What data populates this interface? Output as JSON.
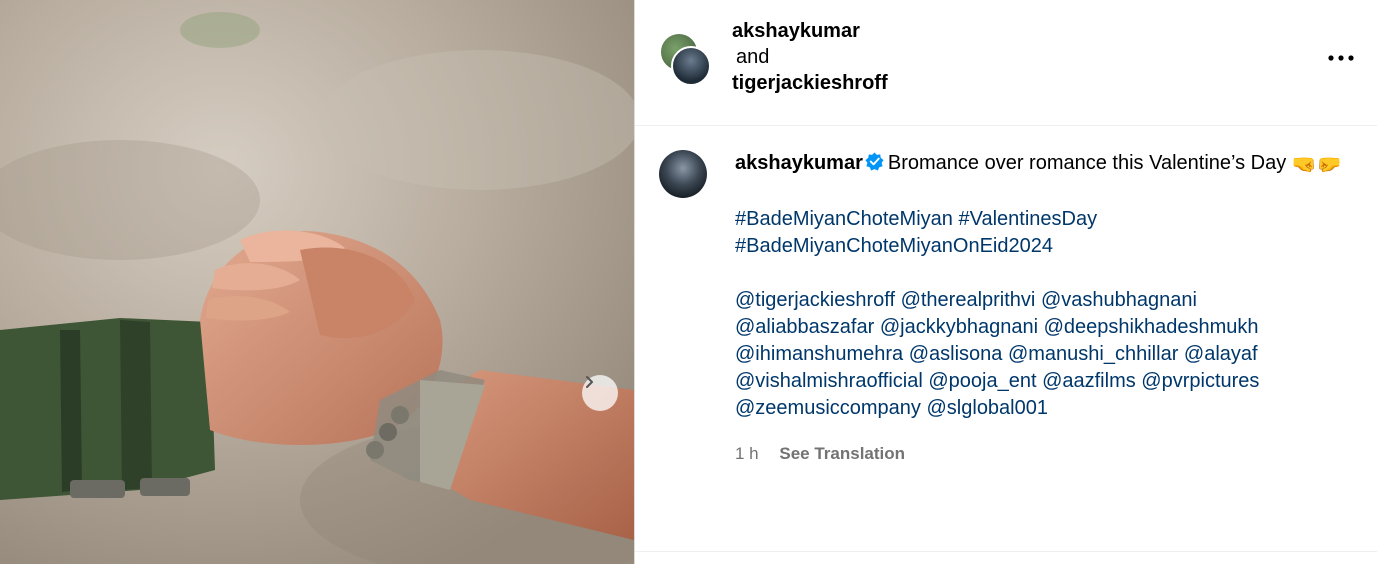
{
  "post": {
    "author": "akshaykumar",
    "collab_joiner": "and",
    "collaborator": "tigerjackieshroff"
  },
  "caption": {
    "username": "akshaykumar",
    "text": "Bromance over romance this Valentine’s Day",
    "emoji": "🤜🤛",
    "hashtags": [
      "#BadeMiyanChoteMiyan",
      "#ValentinesDay",
      "#BadeMiyanChoteMiyanOnEid2024"
    ],
    "mentions": [
      "@tigerjackieshroff",
      "@therealprithvi",
      "@vashubhagnani",
      "@aliabbaszafar",
      "@jackkybhagnani",
      "@deepshikhadeshmukh",
      "@ihimanshumehra",
      "@aslisona",
      "@manushi_chhillar",
      "@alayaf",
      "@vishalmishraofficial",
      "@pooja_ent",
      "@aazfilms",
      "@pvrpictures",
      "@zeemusiccompany",
      "@slglobal001"
    ]
  },
  "meta": {
    "time": "1 h",
    "translate": "See Translation"
  },
  "icons": {
    "more": "more-options-icon",
    "next": "chevron-right-icon",
    "verified": "verified-badge-icon"
  },
  "colors": {
    "link": "#00376b",
    "verified": "#0095f6",
    "muted": "#737373"
  }
}
